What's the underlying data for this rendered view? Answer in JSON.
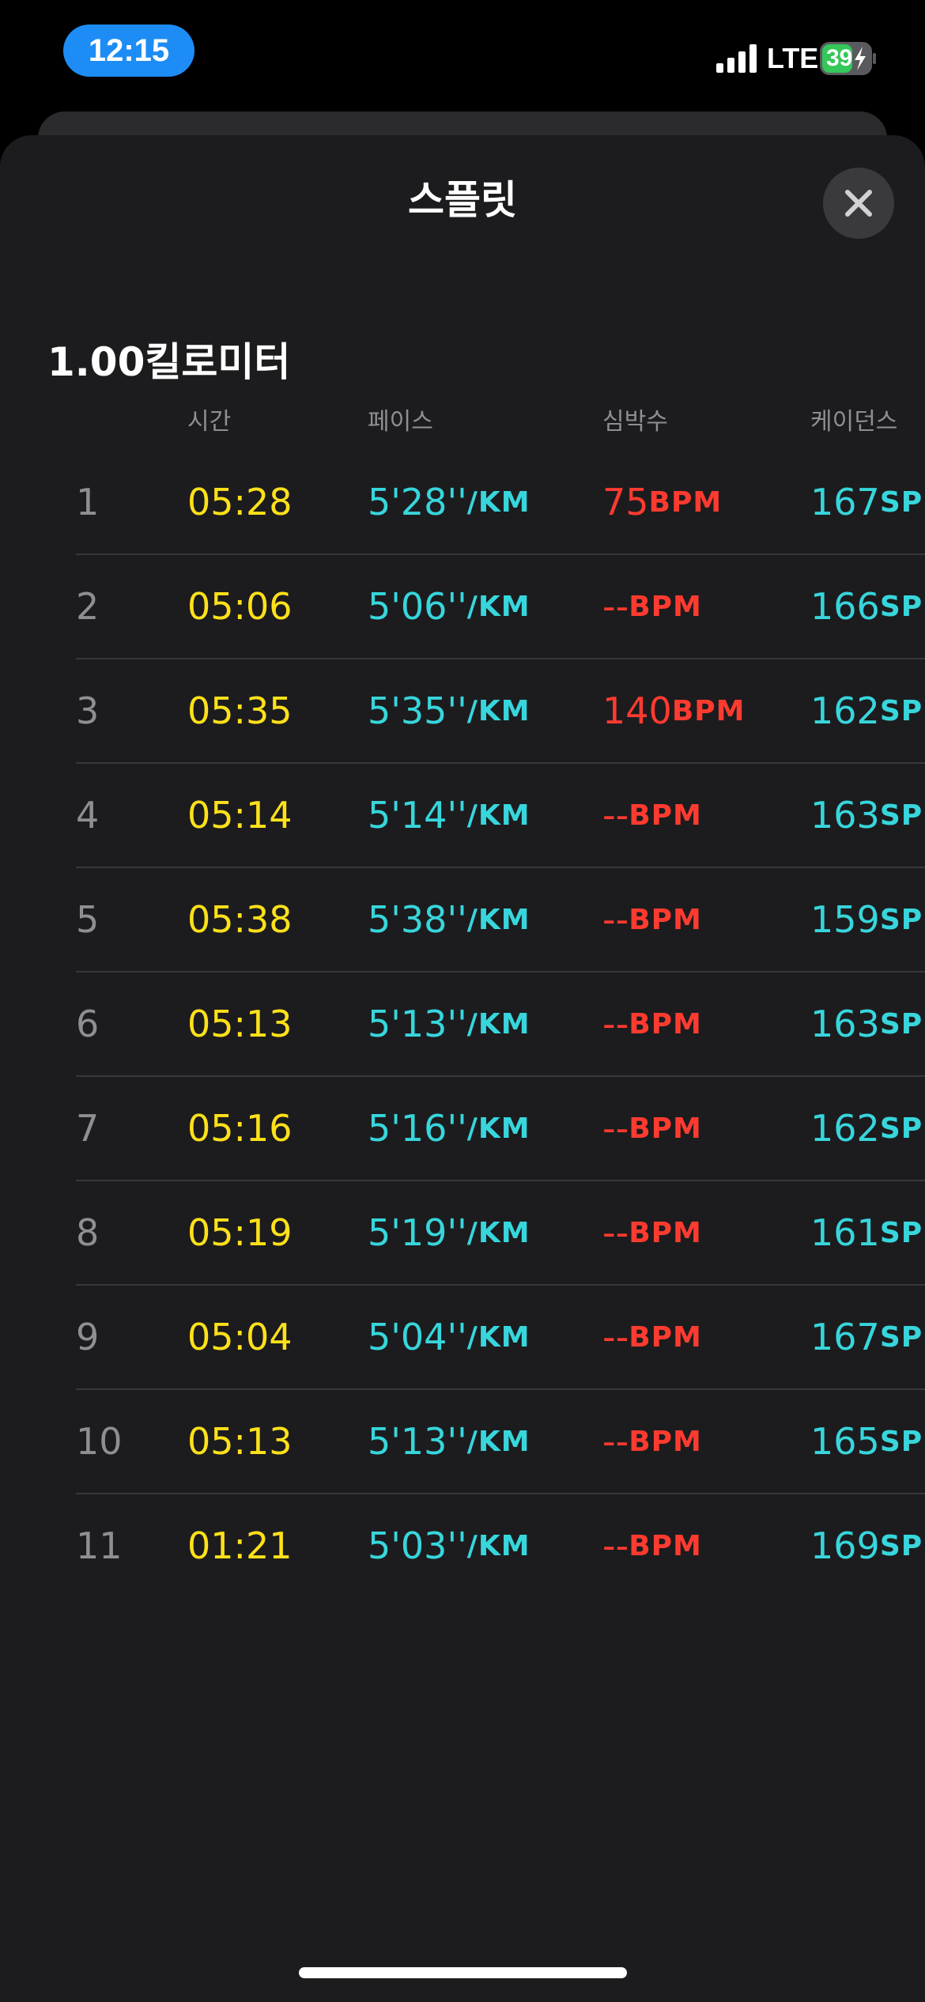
{
  "status_bar": {
    "time": "12:15",
    "network": "LTE",
    "battery_level": "39",
    "battery_color": "#34c759",
    "icons": [
      "signal-icon",
      "battery-charging-icon"
    ]
  },
  "sheet": {
    "title": "스플릿",
    "close_icon": "close-icon"
  },
  "splits": {
    "section_title": "1.00킬로미터",
    "headers": {
      "time": "시간",
      "pace": "페이스",
      "heart_rate": "심박수",
      "cadence": "케이던스"
    },
    "units": {
      "pace": "/KM",
      "heart_rate": "BPM",
      "cadence": "SPM"
    },
    "rows": [
      {
        "index": "1",
        "time": "05:28",
        "pace": "5'28''",
        "heart_rate": "75",
        "cadence": "167"
      },
      {
        "index": "2",
        "time": "05:06",
        "pace": "5'06''",
        "heart_rate": "--",
        "cadence": "166"
      },
      {
        "index": "3",
        "time": "05:35",
        "pace": "5'35''",
        "heart_rate": "140",
        "cadence": "162"
      },
      {
        "index": "4",
        "time": "05:14",
        "pace": "5'14''",
        "heart_rate": "--",
        "cadence": "163"
      },
      {
        "index": "5",
        "time": "05:38",
        "pace": "5'38''",
        "heart_rate": "--",
        "cadence": "159"
      },
      {
        "index": "6",
        "time": "05:13",
        "pace": "5'13''",
        "heart_rate": "--",
        "cadence": "163"
      },
      {
        "index": "7",
        "time": "05:16",
        "pace": "5'16''",
        "heart_rate": "--",
        "cadence": "162"
      },
      {
        "index": "8",
        "time": "05:19",
        "pace": "5'19''",
        "heart_rate": "--",
        "cadence": "161"
      },
      {
        "index": "9",
        "time": "05:04",
        "pace": "5'04''",
        "heart_rate": "--",
        "cadence": "167"
      },
      {
        "index": "10",
        "time": "05:13",
        "pace": "5'13''",
        "heart_rate": "--",
        "cadence": "165"
      },
      {
        "index": "11",
        "time": "01:21",
        "pace": "5'03''",
        "heart_rate": "--",
        "cadence": "169"
      }
    ]
  },
  "colors": {
    "time": "#ffe11a",
    "pace": "#37d6dc",
    "heart_rate": "#ff3b30",
    "cadence": "#37d6dc"
  }
}
